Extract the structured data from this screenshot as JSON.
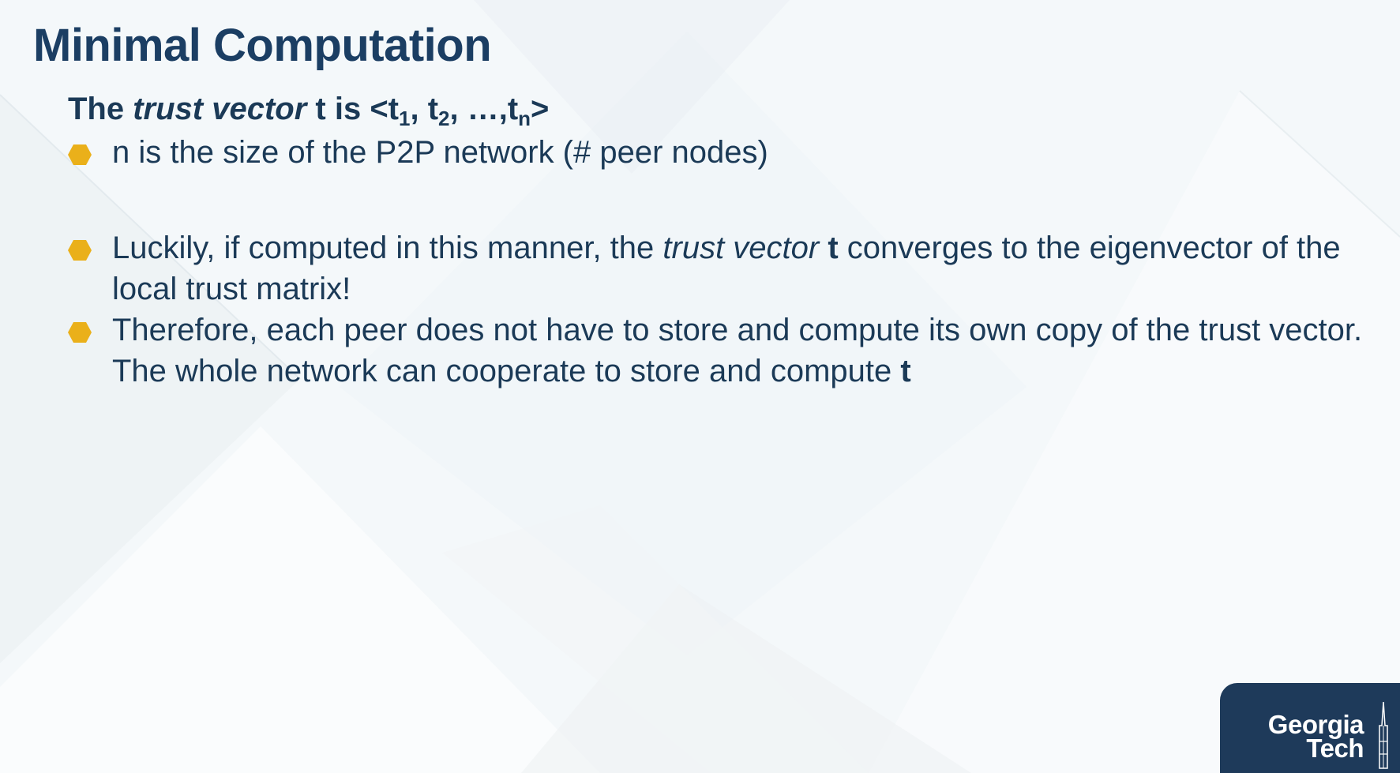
{
  "slide": {
    "title": "Minimal Computation",
    "subheading": {
      "prefix": "The ",
      "italic": "trust vector",
      "bold_t": " t is <t",
      "sub1": "1",
      "mid1": ", t",
      "sub2": "2",
      "mid2": ", …,t",
      "subn": "n",
      "suffix": ">"
    },
    "bullets": [
      {
        "text": "n is the size of the P2P network (# peer nodes)"
      },
      {
        "part1": "Luckily, if computed in this manner, the ",
        "italic": "trust vector",
        "bold": "t",
        "part2": " converges to the eigenvector of the local trust matrix!"
      },
      {
        "part1": "Therefore, each peer does not have to store and compute its own copy of the trust vector. The whole network can cooperate to store and compute ",
        "bold": "t"
      }
    ]
  },
  "logo": {
    "line1": "Georgia",
    "line2": "Tech"
  },
  "colors": {
    "title": "#1b3e63",
    "text": "#1b3a57",
    "bullet": "#eab01a",
    "logo_bg": "#1e3a5a",
    "background": "#f4f8fa"
  }
}
